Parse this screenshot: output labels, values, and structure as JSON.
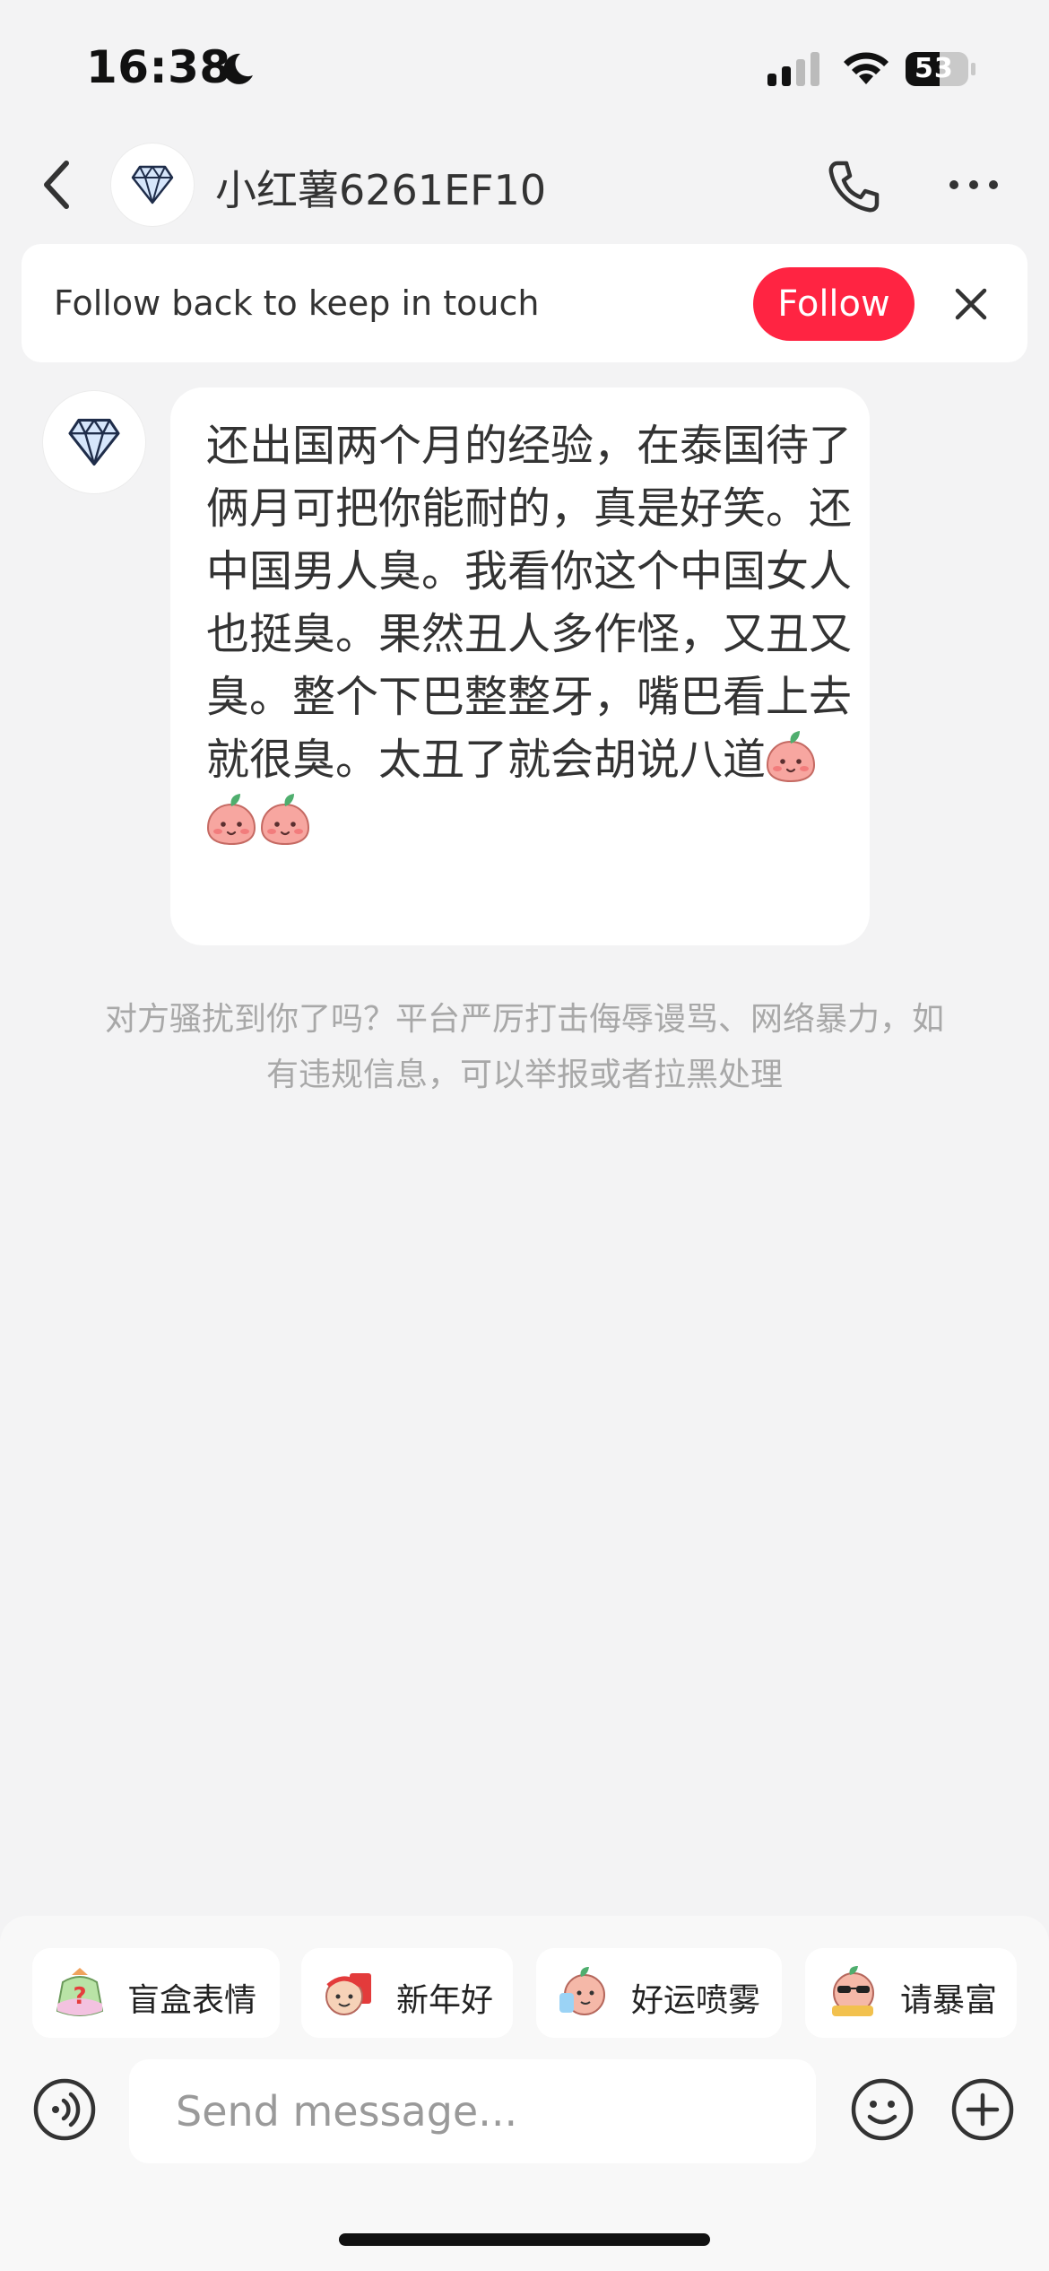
{
  "status_bar": {
    "time": "16:38",
    "battery": "53"
  },
  "header": {
    "title": "小红薯6261EF10"
  },
  "banner": {
    "text": "Follow back to keep in touch",
    "follow_label": "Follow"
  },
  "message": {
    "text": "还出国两个月的经验，在泰国待了俩月可把你能耐的，真是好笑。还中国男人臭。我看你这个中国女人也挺臭。果然丑人多作怪，又丑又臭。整个下巴整整牙，嘴巴看上去就很臭。太丑了就会胡说八道",
    "emoji_name": "peach-face-emoji"
  },
  "notice": "对方骚扰到你了吗？平台严厉打击侮辱谩骂、网络暴力，如有违规信息，可以举报或者拉黑处理",
  "quick_replies": [
    "盲盒表情",
    "新年好",
    "好运喷雾",
    "请暴富"
  ],
  "input": {
    "placeholder": "Send message..."
  },
  "colors": {
    "accent": "#ff2442",
    "background": "#f3f3f4"
  }
}
